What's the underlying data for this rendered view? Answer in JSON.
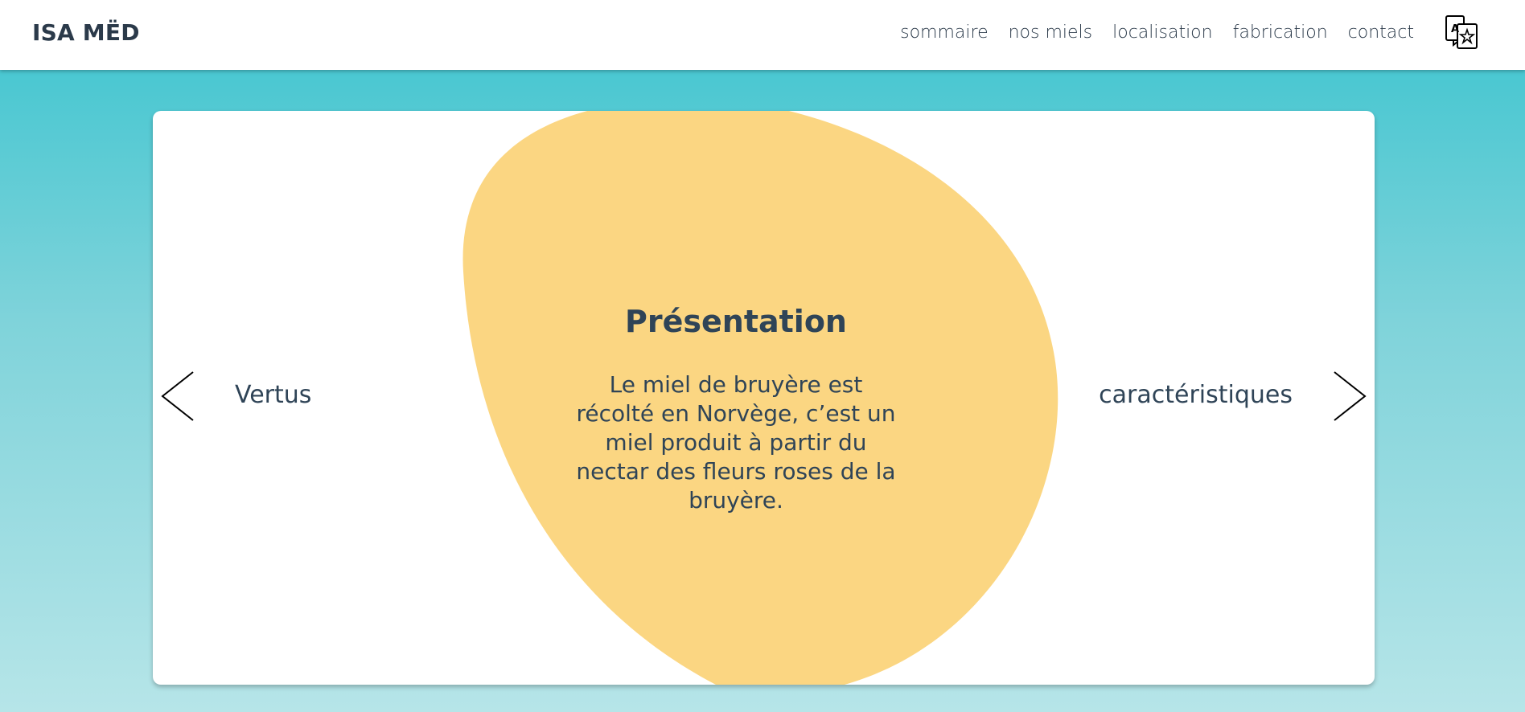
{
  "header": {
    "brand": "ISA MËD",
    "nav": [
      "sommaire",
      "nos miels",
      "localisation",
      "fabrication",
      "contact"
    ],
    "language_icon": "translate-icon"
  },
  "carousel": {
    "title": "Présentation",
    "description": "Le miel de bruyère est récolté en Norvège, c’est un miel produit à partir du nectar des fleurs roses de la bruyère.",
    "prev_label": "Vertus",
    "next_label": "caractéristiques",
    "prev_icon": "chevron-left-icon",
    "next_icon": "chevron-right-icon"
  },
  "colors": {
    "background_top": "#3bc4cf",
    "background_bottom": "#b6e5e8",
    "blob": "#fbd682",
    "text": "#2f4457"
  }
}
